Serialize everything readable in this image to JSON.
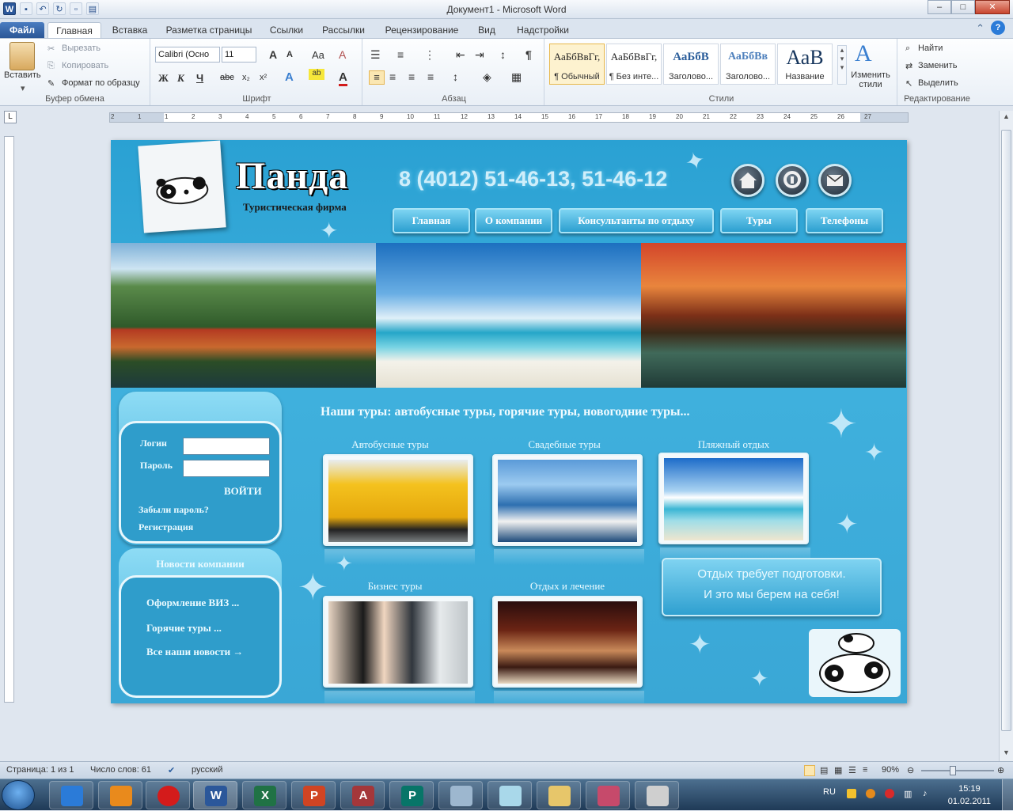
{
  "window": {
    "title": "Документ1 - Microsoft Word",
    "controls": [
      "–",
      "□",
      "✕"
    ]
  },
  "tabs": [
    {
      "label": "Файл"
    },
    {
      "label": "Главная"
    },
    {
      "label": "Вставка"
    },
    {
      "label": "Разметка страницы"
    },
    {
      "label": "Ссылки"
    },
    {
      "label": "Рассылки"
    },
    {
      "label": "Рецензирование"
    },
    {
      "label": "Вид"
    },
    {
      "label": "Надстройки"
    }
  ],
  "ribbon": {
    "clipboard": {
      "paste": "Вставить",
      "cut": "Вырезать",
      "copy": "Копировать",
      "format": "Формат по образцу",
      "label": "Буфер обмена"
    },
    "font": {
      "name": "Calibri (Осно",
      "size": "11",
      "label": "Шрифт",
      "bold": "Ж",
      "italic": "К",
      "underline": "Ч",
      "strike": "abc",
      "sub": "x₂",
      "sup": "x²",
      "grow": "A",
      "shrink": "A",
      "case": "Aa",
      "clear": "A",
      "color": "A"
    },
    "paragraph": {
      "label": "Абзац",
      "pilcrow": "¶"
    },
    "styles": {
      "label": "Стили",
      "items": [
        {
          "sample": "АаБбВвГг,",
          "name": "¶ Обычный"
        },
        {
          "sample": "АаБбВвГг,",
          "name": "¶ Без инте..."
        },
        {
          "sample": "АаБбВ",
          "name": "Заголово..."
        },
        {
          "sample": "АаБбВв",
          "name": "Заголово..."
        },
        {
          "sample": "АаВ",
          "name": "Название"
        }
      ],
      "change": "Изменить стили"
    },
    "editing": {
      "label": "Редактирование",
      "find": "Найти",
      "replace": "Заменить",
      "select": "Выделить"
    }
  },
  "ruler": {
    "labels": [
      "2",
      "1",
      "1",
      "2",
      "3",
      "4",
      "5",
      "6",
      "7",
      "8",
      "9",
      "10",
      "11",
      "12",
      "13",
      "14",
      "15",
      "16",
      "17",
      "18",
      "19",
      "20",
      "21",
      "22",
      "23",
      "24",
      "25",
      "26",
      "27"
    ]
  },
  "site": {
    "brand": "Панда",
    "subtitle": "Туристическая фирма",
    "phone": "8 (4012) 51-46-13, 51-46-12",
    "nav": [
      "Главная",
      "О компании",
      "Консультанты по отдыху",
      "Туры",
      "Телефоны"
    ],
    "login": {
      "login_label": "Логин",
      "password_label": "Пароль",
      "submit": "ВОЙТИ",
      "forgot": "Забыли пароль?",
      "register": "Регистрация"
    },
    "news": {
      "title": "Новости компании",
      "items": [
        "Оформление ВИЗ ...",
        "Горячие туры ...",
        "Все наши новости →"
      ]
    },
    "heading": "Наши туры: автобусные туры, горячие туры, новогодние туры...",
    "tours": [
      "Автобусные туры",
      "Свадебные туры",
      "Пляжный отдых",
      "Бизнес  туры",
      "Отдых и лечение"
    ],
    "slogan": [
      "Отдых требует подготовки.",
      "И это мы берем на себя!"
    ]
  },
  "status": {
    "page": "Страница: 1 из 1",
    "words": "Число слов: 61",
    "lang": "русский",
    "zoom": "90%"
  },
  "taskbar": {
    "apps": [
      "",
      "",
      "",
      "W",
      "X",
      "P",
      "A",
      "P",
      "",
      "",
      "",
      "",
      ""
    ],
    "lang": "RU",
    "time": "15:19",
    "date": "01.02.2011"
  }
}
